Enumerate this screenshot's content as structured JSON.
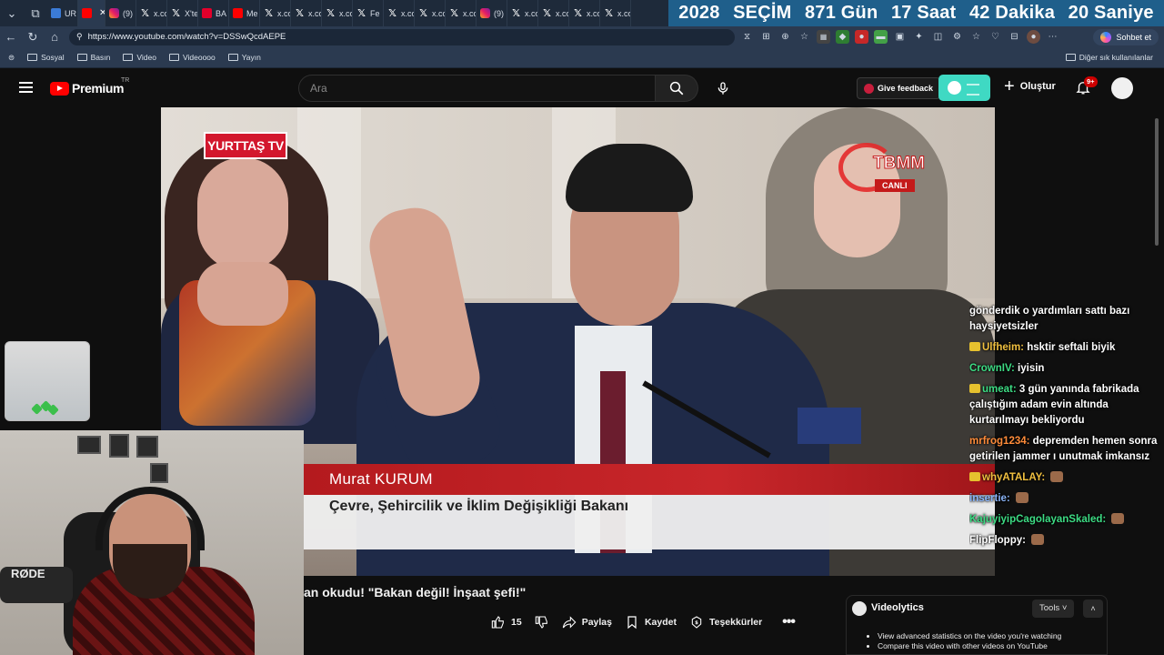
{
  "browser": {
    "tabs": [
      {
        "icon": "ur",
        "label": "UR"
      },
      {
        "icon": "yt",
        "label": "",
        "active": true
      },
      {
        "icon": "ig",
        "label": "(9)"
      },
      {
        "icon": "x",
        "label": "x.co"
      },
      {
        "icon": "x",
        "label": "X'te"
      },
      {
        "icon": "red",
        "label": "BA"
      },
      {
        "icon": "yt",
        "label": "Me"
      },
      {
        "icon": "x",
        "label": "x.co"
      },
      {
        "icon": "x",
        "label": "x.co"
      },
      {
        "icon": "x",
        "label": "x.co"
      },
      {
        "icon": "x",
        "label": "Fe"
      },
      {
        "icon": "x",
        "label": "x.co"
      },
      {
        "icon": "x",
        "label": "x.co"
      },
      {
        "icon": "x",
        "label": "x.co"
      },
      {
        "icon": "ig",
        "label": "(9)"
      },
      {
        "icon": "x",
        "label": "x.co"
      },
      {
        "icon": "x",
        "label": "x.co"
      },
      {
        "icon": "x",
        "label": "x.co"
      },
      {
        "icon": "x",
        "label": "x.co"
      }
    ],
    "countdown": {
      "year": "2028",
      "label": "SEÇİM",
      "days": "871 Gün",
      "hours": "17 Saat",
      "minutes": "42 Dakika",
      "seconds": "20 Saniye"
    },
    "url": "https://www.youtube.com/watch?v=DSSwQcdAEPE",
    "copilot_label": "Sohbet et",
    "bookmarks": [
      "Sosyal",
      "Basın",
      "Video",
      "Videoooo",
      "Yayın"
    ],
    "other_bookmarks": "Diğer sık kullanılanlar"
  },
  "youtube": {
    "logo_text": "Premium",
    "region": "TR",
    "search_placeholder": "Ara",
    "feedback_label": "Give feedback",
    "create_label": "Oluştur",
    "notification_count": "9+"
  },
  "video": {
    "channel_watermark": "YURTTAŞ TV",
    "broadcaster_logo": "TBMM",
    "live_label": "CANLI",
    "lower_third_name": "Murat KURUM",
    "lower_third_title": "Çevre, Şehircilik ve İklim Değişikliği Bakanı",
    "title": "an okudu! \"Bakan değil! İnşaat şefi!\""
  },
  "chat": [
    {
      "user": "",
      "text": "gönderdik o yardımları sattı bazı haysiyetsizler",
      "user_color": "#ffffff"
    },
    {
      "user": "Ulfheim:",
      "text": "hsktir seftali biyik",
      "user_color": "#f0c040",
      "badge": true
    },
    {
      "user": "CrownIV:",
      "text": "iyisin",
      "user_color": "#3ddc84"
    },
    {
      "user": "umeat:",
      "text": "3 gün yanında fabrikada çalıştığım adam evin altında kurtarılmayı bekliyordu",
      "user_color": "#3ddc84",
      "badge": true
    },
    {
      "user": "mrfrog1234:",
      "text": "depremden hemen sonra getirilen jammer ı unutmak imkansız",
      "user_color": "#ff8c3a"
    },
    {
      "user": "whyATALAY:",
      "text": "",
      "user_color": "#f0c040",
      "badge": true,
      "emote": true
    },
    {
      "user": "insertie:",
      "text": "",
      "user_color": "#8ab4f8",
      "emote": true
    },
    {
      "user": "KajuyiyipCagolayanSkaled:",
      "text": "",
      "user_color": "#3ddc84",
      "emote": true
    },
    {
      "user": "FlipFloppy:",
      "text": "",
      "user_color": "#ffffff",
      "emote": true
    }
  ],
  "webcam": {
    "mic_brand": "RØDE"
  },
  "actions": {
    "like_count": "15",
    "share_label": "Paylaş",
    "save_label": "Kaydet",
    "thanks_label": "Teşekkürler"
  },
  "videolytics": {
    "title": "Videolytics",
    "tools_label": "Tools",
    "items": [
      "View advanced statistics on the video you're watching",
      "Compare this video with other videos on YouTube"
    ]
  }
}
